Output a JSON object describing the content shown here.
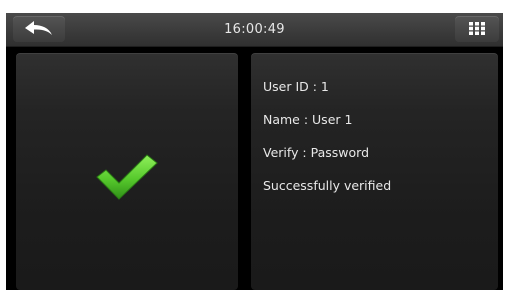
{
  "topbar": {
    "back_icon": "back-arrow-icon",
    "time": "16:00:49",
    "menu_icon": "grid-menu-icon"
  },
  "result": {
    "icon": "checkmark-icon",
    "icon_color": "#6dd63c"
  },
  "info": {
    "user_id": "User ID : 1",
    "name": "Name : User 1",
    "verify": "Verify : Password",
    "status": "Successfully verified"
  }
}
